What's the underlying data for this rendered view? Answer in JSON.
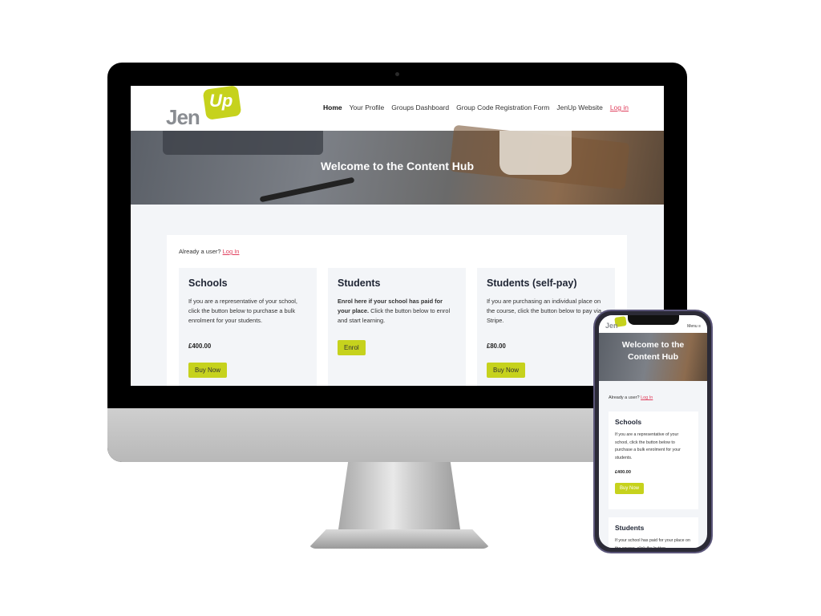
{
  "site": {
    "logo": {
      "text_left": "Jen",
      "text_badge": "Up"
    },
    "nav": [
      "Home",
      "Your Profile",
      "Groups Dashboard",
      "Group Code Registration Form",
      "JenUp Website"
    ],
    "nav_login": "Log in",
    "hero_title": "Welcome to the Content Hub",
    "already_user": "Already a user?",
    "already_login": "Log In",
    "products": [
      {
        "title": "Schools",
        "desc": "If you are a representative of your school, click the button below to purchase a bulk enrolment for your students.",
        "price": "£400.00",
        "button": "Buy Now"
      },
      {
        "title": "Students",
        "desc_bold": "Enrol here if your school has paid for your place.",
        "desc": " Click the button below to enrol and start learning.",
        "button": "Enrol"
      },
      {
        "title": "Students (self-pay)",
        "desc": "If you are purchasing an individual place on the course, click the button below to pay via Stripe.",
        "price": "£80.00",
        "button": "Buy Now"
      }
    ]
  },
  "mobile": {
    "menu_label": "Menu",
    "students_desc": "If your school has paid for your place on the course, click the button"
  },
  "colors": {
    "accent": "#c6d21d",
    "link": "#e0405e",
    "heading": "#1e2433"
  }
}
